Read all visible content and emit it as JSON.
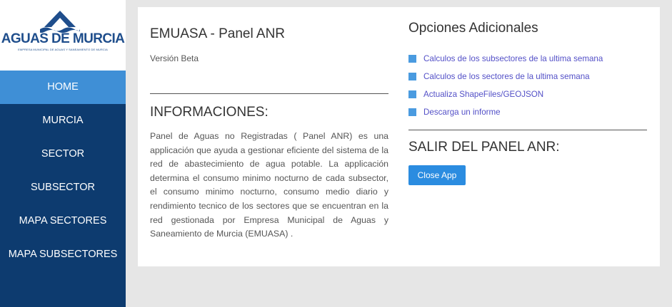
{
  "logo": {
    "name": "AGUAS DE MURCIA",
    "subtitle": "EMPRESA MUNICIPAL DE AGUAS Y SANEAMIENTO DE MURCIA",
    "brand_color": "#1f4e8c"
  },
  "sidebar": {
    "items": [
      {
        "label": "HOME",
        "active": true
      },
      {
        "label": "MURCIA"
      },
      {
        "label": "SECTOR"
      },
      {
        "label": "SUBSECTOR"
      },
      {
        "label": "MAPA SECTORES"
      },
      {
        "label": "MAPA SUBSECTORES"
      }
    ],
    "colors": {
      "background": "#0d3b6f",
      "active": "#3f8fd6"
    }
  },
  "main": {
    "title": "EMUASA - Panel ANR",
    "version": "Versión Beta",
    "info_heading": "INFORMACIONES:",
    "info_text": "Panel de Aguas no Registradas ( Panel ANR) es una applicación que ayuda a gestionar eficiente del sistema de la red de abastecimiento de agua potable. La applicación determina el consumo minimo nocturno de cada subsector, el consumo minimo nocturno, consumo medio diario y rendimiento tecnico de los sectores que se encuentran en la red gestionada por Empresa Municipal de Aguas y Saneamiento de Murcia (EMUASA) ."
  },
  "options": {
    "heading": "Opciones Adicionales",
    "links": [
      "Calculos de los subsectores de la ultima semana",
      "Calculos de los sectores de la ultima semana",
      "Actualiza ShapeFiles/GEOJSON",
      "Descarga un informe"
    ],
    "exit_heading": "SALIR DEL PANEL ANR:",
    "close_button": "Close App"
  }
}
